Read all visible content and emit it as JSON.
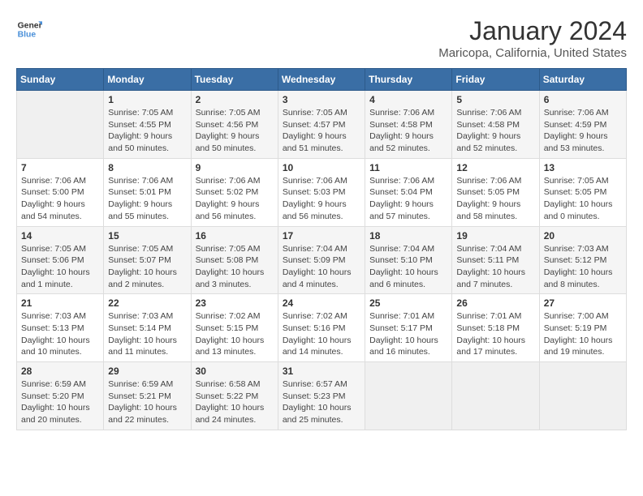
{
  "logo": {
    "text_general": "General",
    "text_blue": "Blue"
  },
  "header": {
    "title": "January 2024",
    "subtitle": "Maricopa, California, United States"
  },
  "weekdays": [
    "Sunday",
    "Monday",
    "Tuesday",
    "Wednesday",
    "Thursday",
    "Friday",
    "Saturday"
  ],
  "weeks": [
    [
      {
        "day": "",
        "empty": true
      },
      {
        "day": "1",
        "sunrise": "7:05 AM",
        "sunset": "4:55 PM",
        "daylight": "9 hours and 50 minutes."
      },
      {
        "day": "2",
        "sunrise": "7:05 AM",
        "sunset": "4:56 PM",
        "daylight": "9 hours and 50 minutes."
      },
      {
        "day": "3",
        "sunrise": "7:05 AM",
        "sunset": "4:57 PM",
        "daylight": "9 hours and 51 minutes."
      },
      {
        "day": "4",
        "sunrise": "7:06 AM",
        "sunset": "4:58 PM",
        "daylight": "9 hours and 52 minutes."
      },
      {
        "day": "5",
        "sunrise": "7:06 AM",
        "sunset": "4:58 PM",
        "daylight": "9 hours and 52 minutes."
      },
      {
        "day": "6",
        "sunrise": "7:06 AM",
        "sunset": "4:59 PM",
        "daylight": "9 hours and 53 minutes."
      }
    ],
    [
      {
        "day": "7",
        "sunrise": "7:06 AM",
        "sunset": "5:00 PM",
        "daylight": "9 hours and 54 minutes."
      },
      {
        "day": "8",
        "sunrise": "7:06 AM",
        "sunset": "5:01 PM",
        "daylight": "9 hours and 55 minutes."
      },
      {
        "day": "9",
        "sunrise": "7:06 AM",
        "sunset": "5:02 PM",
        "daylight": "9 hours and 56 minutes."
      },
      {
        "day": "10",
        "sunrise": "7:06 AM",
        "sunset": "5:03 PM",
        "daylight": "9 hours and 56 minutes."
      },
      {
        "day": "11",
        "sunrise": "7:06 AM",
        "sunset": "5:04 PM",
        "daylight": "9 hours and 57 minutes."
      },
      {
        "day": "12",
        "sunrise": "7:06 AM",
        "sunset": "5:05 PM",
        "daylight": "9 hours and 58 minutes."
      },
      {
        "day": "13",
        "sunrise": "7:05 AM",
        "sunset": "5:05 PM",
        "daylight": "10 hours and 0 minutes."
      }
    ],
    [
      {
        "day": "14",
        "sunrise": "7:05 AM",
        "sunset": "5:06 PM",
        "daylight": "10 hours and 1 minute."
      },
      {
        "day": "15",
        "sunrise": "7:05 AM",
        "sunset": "5:07 PM",
        "daylight": "10 hours and 2 minutes."
      },
      {
        "day": "16",
        "sunrise": "7:05 AM",
        "sunset": "5:08 PM",
        "daylight": "10 hours and 3 minutes."
      },
      {
        "day": "17",
        "sunrise": "7:04 AM",
        "sunset": "5:09 PM",
        "daylight": "10 hours and 4 minutes."
      },
      {
        "day": "18",
        "sunrise": "7:04 AM",
        "sunset": "5:10 PM",
        "daylight": "10 hours and 6 minutes."
      },
      {
        "day": "19",
        "sunrise": "7:04 AM",
        "sunset": "5:11 PM",
        "daylight": "10 hours and 7 minutes."
      },
      {
        "day": "20",
        "sunrise": "7:03 AM",
        "sunset": "5:12 PM",
        "daylight": "10 hours and 8 minutes."
      }
    ],
    [
      {
        "day": "21",
        "sunrise": "7:03 AM",
        "sunset": "5:13 PM",
        "daylight": "10 hours and 10 minutes."
      },
      {
        "day": "22",
        "sunrise": "7:03 AM",
        "sunset": "5:14 PM",
        "daylight": "10 hours and 11 minutes."
      },
      {
        "day": "23",
        "sunrise": "7:02 AM",
        "sunset": "5:15 PM",
        "daylight": "10 hours and 13 minutes."
      },
      {
        "day": "24",
        "sunrise": "7:02 AM",
        "sunset": "5:16 PM",
        "daylight": "10 hours and 14 minutes."
      },
      {
        "day": "25",
        "sunrise": "7:01 AM",
        "sunset": "5:17 PM",
        "daylight": "10 hours and 16 minutes."
      },
      {
        "day": "26",
        "sunrise": "7:01 AM",
        "sunset": "5:18 PM",
        "daylight": "10 hours and 17 minutes."
      },
      {
        "day": "27",
        "sunrise": "7:00 AM",
        "sunset": "5:19 PM",
        "daylight": "10 hours and 19 minutes."
      }
    ],
    [
      {
        "day": "28",
        "sunrise": "6:59 AM",
        "sunset": "5:20 PM",
        "daylight": "10 hours and 20 minutes."
      },
      {
        "day": "29",
        "sunrise": "6:59 AM",
        "sunset": "5:21 PM",
        "daylight": "10 hours and 22 minutes."
      },
      {
        "day": "30",
        "sunrise": "6:58 AM",
        "sunset": "5:22 PM",
        "daylight": "10 hours and 24 minutes."
      },
      {
        "day": "31",
        "sunrise": "6:57 AM",
        "sunset": "5:23 PM",
        "daylight": "10 hours and 25 minutes."
      },
      {
        "day": "",
        "empty": true
      },
      {
        "day": "",
        "empty": true
      },
      {
        "day": "",
        "empty": true
      }
    ]
  ],
  "labels": {
    "sunrise": "Sunrise:",
    "sunset": "Sunset:",
    "daylight": "Daylight:"
  }
}
